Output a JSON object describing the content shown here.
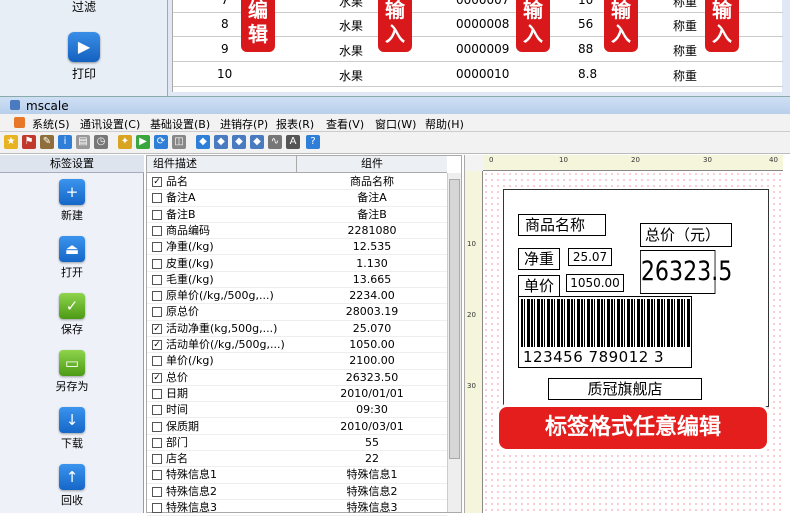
{
  "bg_window": {
    "side_buttons": [
      {
        "label": "过滤"
      },
      {
        "label": "打印"
      }
    ],
    "rows": [
      {
        "no": "7",
        "name": "水果",
        "code": "0000007",
        "qty": "10",
        "mode": "称重"
      },
      {
        "no": "8",
        "name": "水果",
        "code": "0000008",
        "qty": "56",
        "mode": "称重"
      },
      {
        "no": "9",
        "name": "水果",
        "code": "0000009",
        "qty": "88",
        "mode": "称重"
      },
      {
        "no": "10",
        "name": "水果",
        "code": "0000010",
        "qty": "8.8",
        "mode": "称重"
      }
    ],
    "badges": [
      {
        "text": "编辑"
      },
      {
        "text": "输入"
      },
      {
        "text": "输入"
      },
      {
        "text": "输入"
      },
      {
        "text": "输入"
      }
    ]
  },
  "app": {
    "title": "mscale"
  },
  "menu": [
    "系统(S)",
    "通讯设置(C)",
    "基础设置(B)",
    "进销存(P)",
    "报表(R)",
    "查看(V)",
    "窗口(W)",
    "帮助(H)"
  ],
  "left_panel": {
    "header": "标签设置",
    "buttons": [
      {
        "label": "新建",
        "icon": "plus-icon",
        "glyph": "+",
        "color": "blue"
      },
      {
        "label": "打开",
        "icon": "eject-icon",
        "glyph": "⏏",
        "color": "blue"
      },
      {
        "label": "保存",
        "icon": "check-icon",
        "glyph": "✓",
        "color": "green"
      },
      {
        "label": "另存为",
        "icon": "save-as-icon",
        "glyph": "▭",
        "color": "green"
      },
      {
        "label": "下载",
        "icon": "arrow-down-icon",
        "glyph": "↓",
        "color": "blue"
      },
      {
        "label": "回收",
        "icon": "arrow-up-icon",
        "glyph": "↑",
        "color": "blue"
      }
    ]
  },
  "grid": {
    "col_desc": "组件描述",
    "col_comp": "组件",
    "rows": [
      {
        "checked": true,
        "name": "品名",
        "value": "商品名称"
      },
      {
        "checked": false,
        "name": "备注A",
        "value": "备注A"
      },
      {
        "checked": false,
        "name": "备注B",
        "value": "备注B"
      },
      {
        "checked": false,
        "name": "商品编码",
        "value": "2281080"
      },
      {
        "checked": false,
        "name": "净重(/kg)",
        "value": "12.535"
      },
      {
        "checked": false,
        "name": "皮重(/kg)",
        "value": "1.130"
      },
      {
        "checked": false,
        "name": "毛重(/kg)",
        "value": "13.665"
      },
      {
        "checked": false,
        "name": "原单价(/kg,/500g,...)",
        "value": "2234.00"
      },
      {
        "checked": false,
        "name": "原总价",
        "value": "28003.19"
      },
      {
        "checked": true,
        "name": "活动净重(kg,500g,...)",
        "value": "25.070"
      },
      {
        "checked": true,
        "name": "活动单价(/kg,/500g,...)",
        "value": "1050.00"
      },
      {
        "checked": false,
        "name": "单价(/kg)",
        "value": "2100.00"
      },
      {
        "checked": true,
        "name": "总价",
        "value": "26323.50"
      },
      {
        "checked": false,
        "name": "日期",
        "value": "2010/01/01"
      },
      {
        "checked": false,
        "name": "时间",
        "value": "09:30"
      },
      {
        "checked": false,
        "name": "保质期",
        "value": "2010/03/01"
      },
      {
        "checked": false,
        "name": "部门",
        "value": "55"
      },
      {
        "checked": false,
        "name": "店名",
        "value": "22"
      },
      {
        "checked": false,
        "name": "特殊信息1",
        "value": "特殊信息1"
      },
      {
        "checked": false,
        "name": "特殊信息2",
        "value": "特殊信息2"
      },
      {
        "checked": false,
        "name": "特殊信息3",
        "value": "特殊信息3"
      }
    ]
  },
  "ruler": {
    "top": [
      "0",
      "10",
      "20",
      "30",
      "40"
    ],
    "left": [
      "10",
      "20",
      "30"
    ]
  },
  "label": {
    "product_name": "商品名称",
    "net_weight_label": "净重",
    "net_weight": "25.07",
    "unit_price_label": "单价",
    "unit_price": "1050.00",
    "total_label": "总价（元）",
    "total": "26323.5",
    "barcode_text": "123456 789012 3",
    "store": "质冠旗舰店"
  },
  "banner": "标签格式任意编辑"
}
